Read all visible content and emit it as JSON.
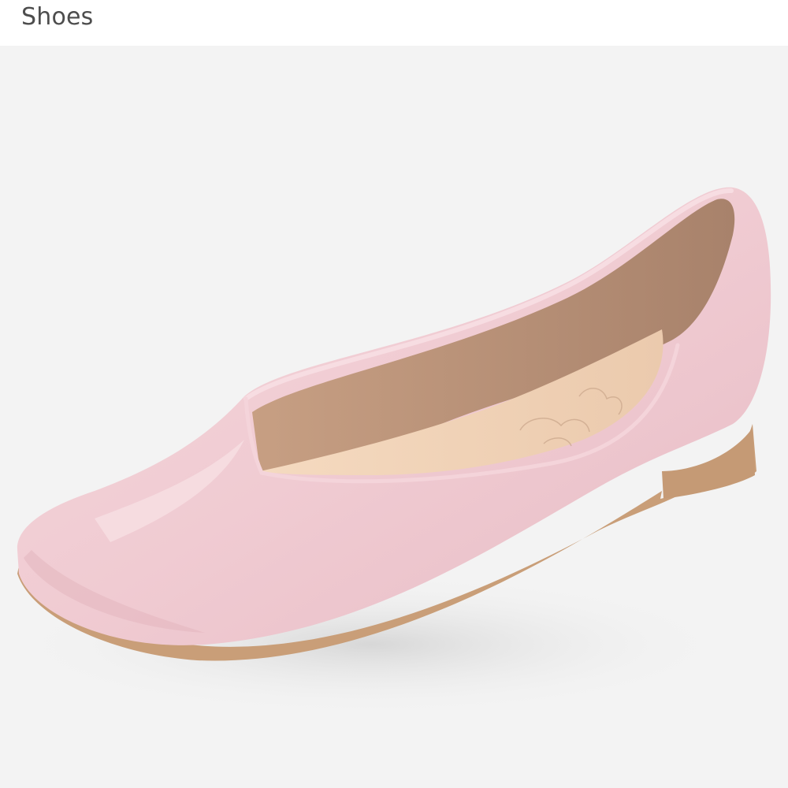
{
  "header": {
    "title": "Shoes"
  },
  "product_image": {
    "subject": "pink-flat-shoe",
    "colors": {
      "background": "#f3f3f3",
      "upper": "#f1cdd3",
      "lining": "#d8b396",
      "insole": "#f0d2b6",
      "sole": "#c99e78"
    }
  }
}
